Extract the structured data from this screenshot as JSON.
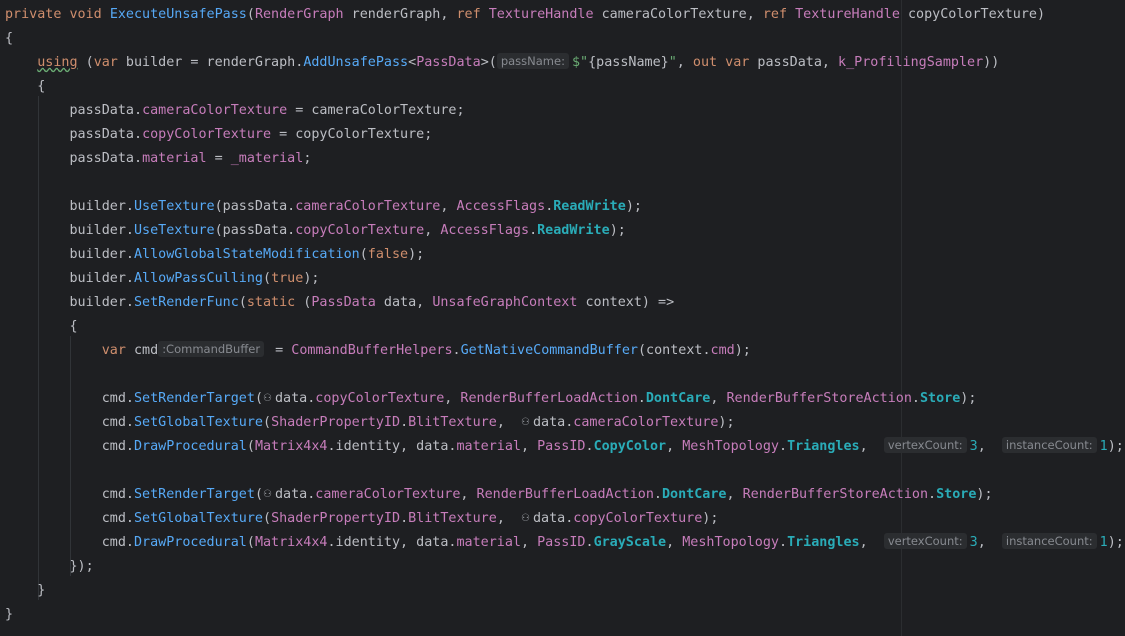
{
  "editor": {
    "lines": [
      [
        {
          "t": "private",
          "c": "keyword"
        },
        {
          "t": " ",
          "c": "text"
        },
        {
          "t": "void",
          "c": "keyword"
        },
        {
          "t": " ",
          "c": "text"
        },
        {
          "t": "ExecuteUnsafePass",
          "c": "method"
        },
        {
          "t": "(",
          "c": "text"
        },
        {
          "t": "RenderGraph",
          "c": "type"
        },
        {
          "t": " renderGraph, ",
          "c": "text"
        },
        {
          "t": "ref",
          "c": "keyword"
        },
        {
          "t": " ",
          "c": "text"
        },
        {
          "t": "TextureHandle",
          "c": "type"
        },
        {
          "t": " cameraColorTexture, ",
          "c": "text"
        },
        {
          "t": "ref",
          "c": "keyword"
        },
        {
          "t": " ",
          "c": "text"
        },
        {
          "t": "TextureHandle",
          "c": "type"
        },
        {
          "t": " copyColorTexture)",
          "c": "text"
        }
      ],
      [
        {
          "t": "{",
          "c": "text"
        }
      ],
      [
        {
          "t": "    ",
          "c": "text"
        },
        {
          "t": "using",
          "c": "keyword",
          "u": true
        },
        {
          "t": " (",
          "c": "text"
        },
        {
          "t": "var",
          "c": "keyword"
        },
        {
          "t": " builder = renderGraph.",
          "c": "text"
        },
        {
          "t": "AddUnsafePass",
          "c": "call"
        },
        {
          "t": "<",
          "c": "text"
        },
        {
          "t": "PassData",
          "c": "type"
        },
        {
          "t": ">(",
          "c": "text"
        },
        {
          "h": "passName:"
        },
        {
          "t": "$\"",
          "c": "string"
        },
        {
          "t": "{passName}",
          "c": "text"
        },
        {
          "t": "\"",
          "c": "string"
        },
        {
          "t": ", ",
          "c": "text"
        },
        {
          "t": "out",
          "c": "keyword"
        },
        {
          "t": " ",
          "c": "text"
        },
        {
          "t": "var",
          "c": "keyword"
        },
        {
          "t": " passData, ",
          "c": "text"
        },
        {
          "t": "k_ProfilingSampler",
          "c": "field"
        },
        {
          "t": "))",
          "c": "text"
        }
      ],
      [
        {
          "t": "    {",
          "c": "text"
        }
      ],
      [
        {
          "t": "        passData.",
          "c": "text"
        },
        {
          "t": "cameraColorTexture",
          "c": "field"
        },
        {
          "t": " = cameraColorTexture;",
          "c": "text"
        }
      ],
      [
        {
          "t": "        passData.",
          "c": "text"
        },
        {
          "t": "copyColorTexture",
          "c": "field"
        },
        {
          "t": " = copyColorTexture;",
          "c": "text"
        }
      ],
      [
        {
          "t": "        passData.",
          "c": "text"
        },
        {
          "t": "material",
          "c": "field"
        },
        {
          "t": " = ",
          "c": "text"
        },
        {
          "t": "_material",
          "c": "field"
        },
        {
          "t": ";",
          "c": "text"
        }
      ],
      [],
      [
        {
          "t": "        builder.",
          "c": "text"
        },
        {
          "t": "UseTexture",
          "c": "call"
        },
        {
          "t": "(passData.",
          "c": "text"
        },
        {
          "t": "cameraColorTexture",
          "c": "field"
        },
        {
          "t": ", ",
          "c": "text"
        },
        {
          "t": "AccessFlags",
          "c": "type"
        },
        {
          "t": ".",
          "c": "text"
        },
        {
          "t": "ReadWrite",
          "c": "mono",
          "b": true
        },
        {
          "t": ");",
          "c": "text"
        }
      ],
      [
        {
          "t": "        builder.",
          "c": "text"
        },
        {
          "t": "UseTexture",
          "c": "call"
        },
        {
          "t": "(passData.",
          "c": "text"
        },
        {
          "t": "copyColorTexture",
          "c": "field"
        },
        {
          "t": ", ",
          "c": "text"
        },
        {
          "t": "AccessFlags",
          "c": "type"
        },
        {
          "t": ".",
          "c": "text"
        },
        {
          "t": "ReadWrite",
          "c": "mono",
          "b": true
        },
        {
          "t": ");",
          "c": "text"
        }
      ],
      [
        {
          "t": "        builder.",
          "c": "text"
        },
        {
          "t": "AllowGlobalStateModification",
          "c": "call"
        },
        {
          "t": "(",
          "c": "text"
        },
        {
          "t": "false",
          "c": "keyword"
        },
        {
          "t": ");",
          "c": "text"
        }
      ],
      [
        {
          "t": "        builder.",
          "c": "text"
        },
        {
          "t": "AllowPassCulling",
          "c": "call"
        },
        {
          "t": "(",
          "c": "text"
        },
        {
          "t": "true",
          "c": "keyword"
        },
        {
          "t": ");",
          "c": "text"
        }
      ],
      [
        {
          "t": "        builder.",
          "c": "text"
        },
        {
          "t": "SetRenderFunc",
          "c": "call"
        },
        {
          "t": "(",
          "c": "text"
        },
        {
          "t": "static",
          "c": "keyword"
        },
        {
          "t": " (",
          "c": "text"
        },
        {
          "t": "PassData",
          "c": "type"
        },
        {
          "t": " data, ",
          "c": "text"
        },
        {
          "t": "UnsafeGraphContext",
          "c": "type"
        },
        {
          "t": " context) =>",
          "c": "text"
        }
      ],
      [
        {
          "t": "        {",
          "c": "text"
        }
      ],
      [
        {
          "t": "            ",
          "c": "text"
        },
        {
          "t": "var",
          "c": "keyword"
        },
        {
          "t": " cmd",
          "c": "text"
        },
        {
          "h": ":CommandBuffer"
        },
        {
          "t": " = ",
          "c": "text"
        },
        {
          "t": "CommandBufferHelpers",
          "c": "type"
        },
        {
          "t": ".",
          "c": "text"
        },
        {
          "t": "GetNativeCommandBuffer",
          "c": "call"
        },
        {
          "t": "(context.",
          "c": "text"
        },
        {
          "t": "cmd",
          "c": "field"
        },
        {
          "t": ");",
          "c": "text"
        }
      ],
      [],
      [
        {
          "t": "            cmd.",
          "c": "text"
        },
        {
          "t": "SetRenderTarget",
          "c": "call"
        },
        {
          "t": "(",
          "c": "text"
        },
        {
          "i": "⚇"
        },
        {
          "t": "data.",
          "c": "text"
        },
        {
          "t": "copyColorTexture",
          "c": "field"
        },
        {
          "t": ", ",
          "c": "text"
        },
        {
          "t": "RenderBufferLoadAction",
          "c": "type"
        },
        {
          "t": ".",
          "c": "text"
        },
        {
          "t": "DontCare",
          "c": "mono",
          "b": true
        },
        {
          "t": ", ",
          "c": "text"
        },
        {
          "t": "RenderBufferStoreAction",
          "c": "type"
        },
        {
          "t": ".",
          "c": "text"
        },
        {
          "t": "Store",
          "c": "mono",
          "b": true
        },
        {
          "t": ");",
          "c": "text"
        }
      ],
      [
        {
          "t": "            cmd.",
          "c": "text"
        },
        {
          "t": "SetGlobalTexture",
          "c": "call"
        },
        {
          "t": "(",
          "c": "text"
        },
        {
          "t": "ShaderPropertyID",
          "c": "type"
        },
        {
          "t": ".",
          "c": "text"
        },
        {
          "t": "BlitTexture",
          "c": "field"
        },
        {
          "t": ",  ",
          "c": "text"
        },
        {
          "i": "⚇"
        },
        {
          "t": "data.",
          "c": "text"
        },
        {
          "t": "cameraColorTexture",
          "c": "field"
        },
        {
          "t": ");",
          "c": "text"
        }
      ],
      [
        {
          "t": "            cmd.",
          "c": "text"
        },
        {
          "t": "DrawProcedural",
          "c": "call"
        },
        {
          "t": "(",
          "c": "text"
        },
        {
          "t": "Matrix4x4",
          "c": "type"
        },
        {
          "t": ".identity, data.",
          "c": "text"
        },
        {
          "t": "material",
          "c": "field"
        },
        {
          "t": ", ",
          "c": "text"
        },
        {
          "t": "PassID",
          "c": "type"
        },
        {
          "t": ".",
          "c": "text"
        },
        {
          "t": "CopyColor",
          "c": "mono",
          "b": true
        },
        {
          "t": ", ",
          "c": "text"
        },
        {
          "t": "MeshTopology",
          "c": "type"
        },
        {
          "t": ".",
          "c": "text"
        },
        {
          "t": "Triangles",
          "c": "mono",
          "b": true
        },
        {
          "t": ",  ",
          "c": "text"
        },
        {
          "h": "vertexCount:"
        },
        {
          "t": "3",
          "c": "mono"
        },
        {
          "t": ",  ",
          "c": "text"
        },
        {
          "h": "instanceCount:"
        },
        {
          "t": "1",
          "c": "mono"
        },
        {
          "t": ");",
          "c": "text"
        }
      ],
      [],
      [
        {
          "t": "            cmd.",
          "c": "text"
        },
        {
          "t": "SetRenderTarget",
          "c": "call"
        },
        {
          "t": "(",
          "c": "text"
        },
        {
          "i": "⚇"
        },
        {
          "t": "data.",
          "c": "text"
        },
        {
          "t": "cameraColorTexture",
          "c": "field"
        },
        {
          "t": ", ",
          "c": "text"
        },
        {
          "t": "RenderBufferLoadAction",
          "c": "type"
        },
        {
          "t": ".",
          "c": "text"
        },
        {
          "t": "DontCare",
          "c": "mono",
          "b": true
        },
        {
          "t": ", ",
          "c": "text"
        },
        {
          "t": "RenderBufferStoreAction",
          "c": "type"
        },
        {
          "t": ".",
          "c": "text"
        },
        {
          "t": "Store",
          "c": "mono",
          "b": true
        },
        {
          "t": ");",
          "c": "text"
        }
      ],
      [
        {
          "t": "            cmd.",
          "c": "text"
        },
        {
          "t": "SetGlobalTexture",
          "c": "call"
        },
        {
          "t": "(",
          "c": "text"
        },
        {
          "t": "ShaderPropertyID",
          "c": "type"
        },
        {
          "t": ".",
          "c": "text"
        },
        {
          "t": "BlitTexture",
          "c": "field"
        },
        {
          "t": ",  ",
          "c": "text"
        },
        {
          "i": "⚇"
        },
        {
          "t": "data.",
          "c": "text"
        },
        {
          "t": "copyColorTexture",
          "c": "field"
        },
        {
          "t": ");",
          "c": "text"
        }
      ],
      [
        {
          "t": "            cmd.",
          "c": "text"
        },
        {
          "t": "DrawProcedural",
          "c": "call"
        },
        {
          "t": "(",
          "c": "text"
        },
        {
          "t": "Matrix4x4",
          "c": "type"
        },
        {
          "t": ".identity, data.",
          "c": "text"
        },
        {
          "t": "material",
          "c": "field"
        },
        {
          "t": ", ",
          "c": "text"
        },
        {
          "t": "PassID",
          "c": "type"
        },
        {
          "t": ".",
          "c": "text"
        },
        {
          "t": "GrayScale",
          "c": "mono",
          "b": true
        },
        {
          "t": ", ",
          "c": "text"
        },
        {
          "t": "MeshTopology",
          "c": "type"
        },
        {
          "t": ".",
          "c": "text"
        },
        {
          "t": "Triangles",
          "c": "mono",
          "b": true
        },
        {
          "t": ",  ",
          "c": "text"
        },
        {
          "h": "vertexCount:"
        },
        {
          "t": "3",
          "c": "mono"
        },
        {
          "t": ",  ",
          "c": "text"
        },
        {
          "h": "instanceCount:"
        },
        {
          "t": "1",
          "c": "mono"
        },
        {
          "t": ");",
          "c": "text"
        }
      ],
      [
        {
          "t": "        });",
          "c": "text"
        }
      ],
      [
        {
          "t": "    }",
          "c": "text"
        }
      ],
      [
        {
          "t": "}",
          "c": "text"
        }
      ]
    ]
  },
  "colors": {
    "background": "#1e1f22",
    "keyword": "#cf8e6d",
    "type": "#c77dbb",
    "method": "#56a8f5",
    "string": "#6aab73",
    "number": "#2aacb8",
    "text": "#bcbec4",
    "hint": "#878a90"
  }
}
